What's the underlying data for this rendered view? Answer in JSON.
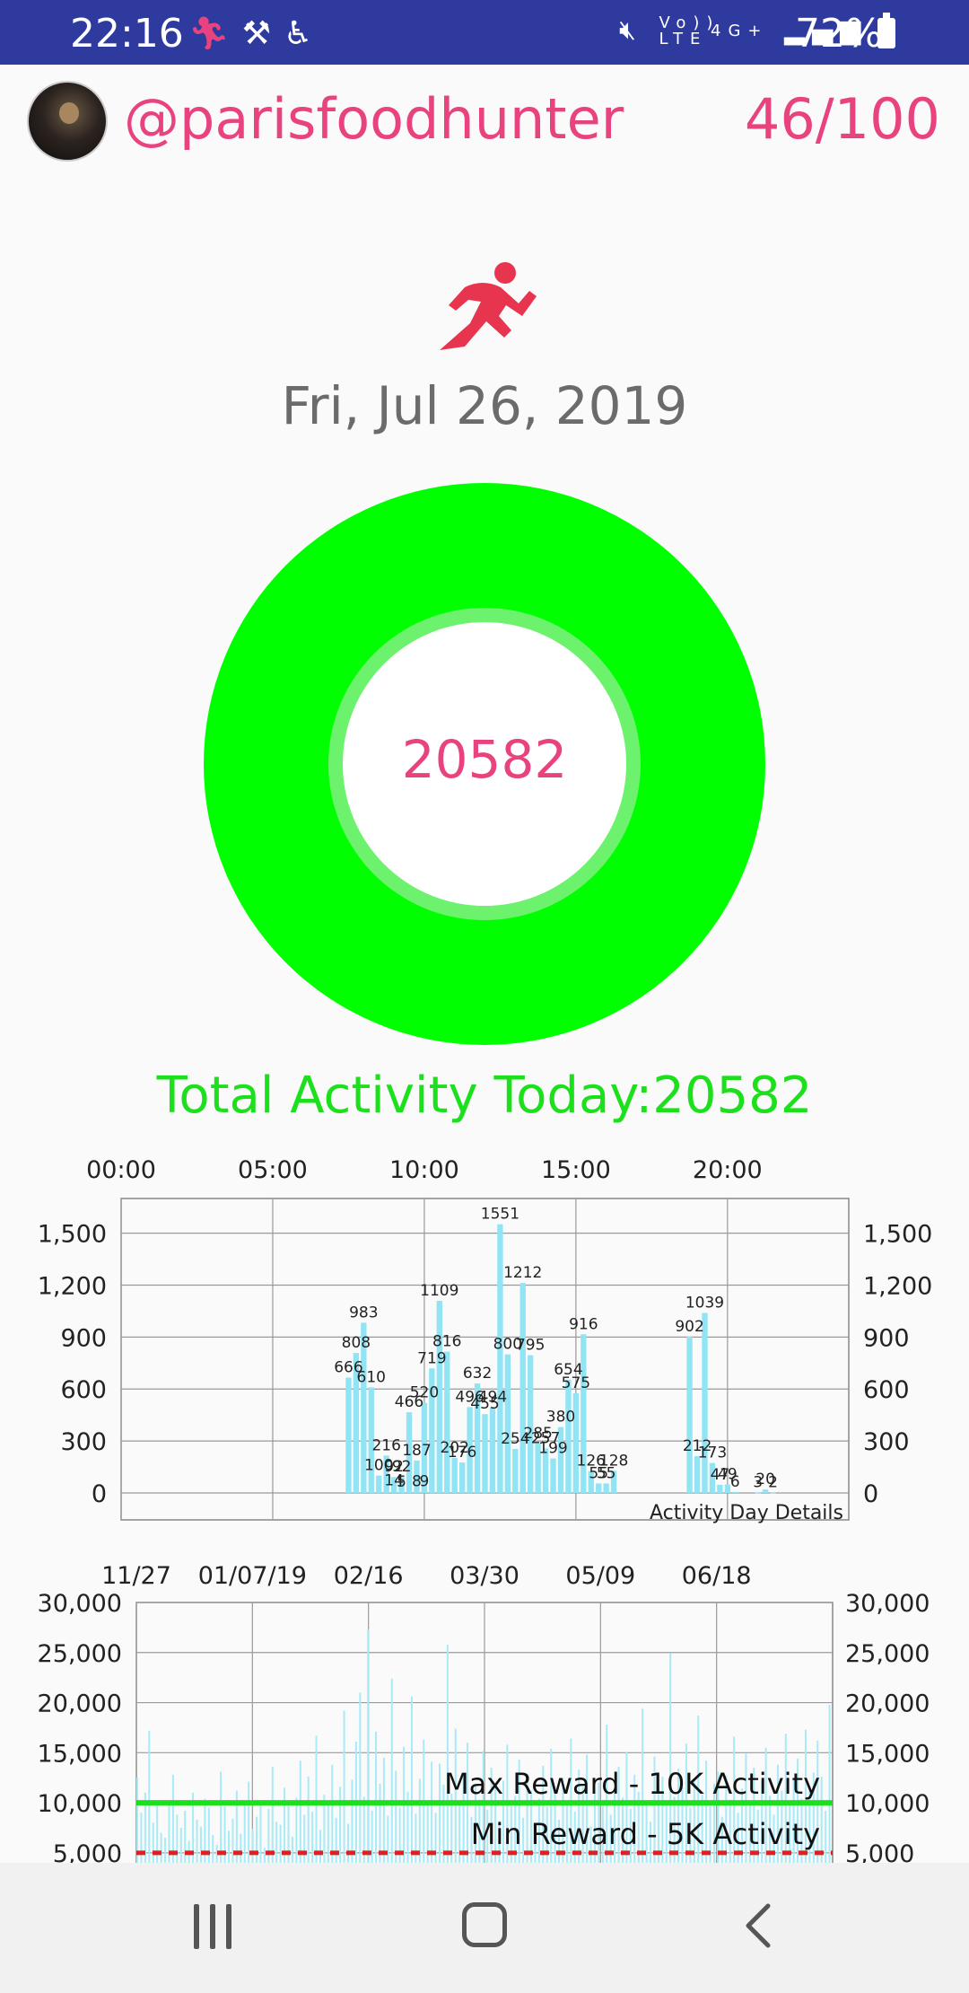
{
  "status_bar": {
    "time": "22:16",
    "left_icons": [
      "running-notification-icon",
      "broom-icon",
      "accessibility-icon"
    ],
    "right_icons": [
      "mute-icon",
      "volte-icon",
      "4g-icon",
      "signal-icon"
    ],
    "network_volte": "Vo)) LTE",
    "network_4g": "4G+",
    "battery_percent": "72%",
    "color": "#2e3a9e"
  },
  "header": {
    "username": "@parisfoodhunter",
    "progress": "46/100",
    "accent_color": "#e8437f"
  },
  "date": "Fri, Jul 26, 2019",
  "ring": {
    "value": "20582",
    "ring_color": "#00ff00",
    "inner_ring_color": "#6cf26c"
  },
  "total_activity": "Total Activity Today:20582",
  "daily_chart": {
    "x_ticks": [
      "00:00",
      "05:00",
      "10:00",
      "15:00",
      "20:00"
    ],
    "y_ticks": [
      "0",
      "300",
      "600",
      "900",
      "1,200",
      "1,500"
    ],
    "caption": "Activity Day Details"
  },
  "history_chart": {
    "x_ticks": [
      "11/27",
      "01/07/19",
      "02/16",
      "03/30",
      "05/09",
      "06/18"
    ],
    "y_ticks": [
      "5,000",
      "10,000",
      "15,000",
      "20,000",
      "25,000",
      "30,000"
    ],
    "max_line_label": "Max Reward - 10K Activity",
    "min_line_label": "Min Reward - 5K Activity"
  },
  "chart_data": [
    {
      "type": "bar",
      "title": "",
      "caption": "Activity Day Details",
      "x_unit": "hour of day",
      "xlim": [
        0,
        24
      ],
      "ylim": [
        0,
        1700
      ],
      "y_ticks": [
        0,
        300,
        600,
        900,
        1200,
        1500
      ],
      "bar_color": "#90e4f4",
      "points": [
        {
          "x": 9.0,
          "y": 14,
          "label": "14"
        },
        {
          "x": 9.25,
          "y": 5,
          "label": "5"
        },
        {
          "x": 9.75,
          "y": 8,
          "label": "8"
        },
        {
          "x": 10.0,
          "y": 9,
          "label": "9"
        },
        {
          "x": 7.5,
          "y": 666,
          "label": "666"
        },
        {
          "x": 7.75,
          "y": 808,
          "label": "808"
        },
        {
          "x": 8.0,
          "y": 983,
          "label": "983"
        },
        {
          "x": 8.25,
          "y": 610,
          "label": "610"
        },
        {
          "x": 8.5,
          "y": 100,
          "label": "100"
        },
        {
          "x": 8.75,
          "y": 216,
          "label": "216"
        },
        {
          "x": 9.0,
          "y": 92,
          "label": "92"
        },
        {
          "x": 9.25,
          "y": 92,
          "label": "92"
        },
        {
          "x": 9.5,
          "y": 466,
          "label": "466"
        },
        {
          "x": 9.75,
          "y": 187,
          "label": "187"
        },
        {
          "x": 10.0,
          "y": 520,
          "label": "520"
        },
        {
          "x": 10.25,
          "y": 719,
          "label": "719"
        },
        {
          "x": 10.5,
          "y": 1109,
          "label": "1109"
        },
        {
          "x": 10.75,
          "y": 816,
          "label": "816"
        },
        {
          "x": 11.0,
          "y": 202,
          "label": "202"
        },
        {
          "x": 11.25,
          "y": 176,
          "label": "176"
        },
        {
          "x": 11.5,
          "y": 496,
          "label": "496"
        },
        {
          "x": 11.75,
          "y": 632,
          "label": "632"
        },
        {
          "x": 12.0,
          "y": 455,
          "label": "455"
        },
        {
          "x": 12.25,
          "y": 494,
          "label": "494"
        },
        {
          "x": 12.5,
          "y": 1551,
          "label": "1551"
        },
        {
          "x": 12.75,
          "y": 800,
          "label": "800"
        },
        {
          "x": 13.0,
          "y": 254,
          "label": "254"
        },
        {
          "x": 13.25,
          "y": 1212,
          "label": "1212"
        },
        {
          "x": 13.5,
          "y": 795,
          "label": "795"
        },
        {
          "x": 13.75,
          "y": 285,
          "label": "285"
        },
        {
          "x": 14.0,
          "y": 257,
          "label": "257"
        },
        {
          "x": 14.25,
          "y": 199,
          "label": "199"
        },
        {
          "x": 14.5,
          "y": 380,
          "label": "380"
        },
        {
          "x": 14.75,
          "y": 654,
          "label": "654"
        },
        {
          "x": 15.0,
          "y": 575,
          "label": "575"
        },
        {
          "x": 15.25,
          "y": 916,
          "label": "916"
        },
        {
          "x": 15.5,
          "y": 126,
          "label": "126"
        },
        {
          "x": 15.75,
          "y": 55,
          "label": "55"
        },
        {
          "x": 16.0,
          "y": 55,
          "label": "55"
        },
        {
          "x": 16.25,
          "y": 128,
          "label": "128"
        },
        {
          "x": 18.75,
          "y": 902,
          "label": "902"
        },
        {
          "x": 19.0,
          "y": 212,
          "label": "212"
        },
        {
          "x": 19.25,
          "y": 1039,
          "label": "1039"
        },
        {
          "x": 19.5,
          "y": 173,
          "label": "173"
        },
        {
          "x": 19.75,
          "y": 47,
          "label": "47"
        },
        {
          "x": 20.0,
          "y": 49,
          "label": "49"
        },
        {
          "x": 20.25,
          "y": 6,
          "label": "6"
        },
        {
          "x": 21.0,
          "y": 3,
          "label": "3"
        },
        {
          "x": 21.25,
          "y": 20,
          "label": "20"
        },
        {
          "x": 21.5,
          "y": 2,
          "label": "2"
        }
      ]
    },
    {
      "type": "bar",
      "title": "",
      "x_labels": [
        "11/27",
        "01/07/19",
        "02/16",
        "03/30",
        "05/09",
        "06/18"
      ],
      "ylim": [
        4000,
        30000
      ],
      "y_ticks": [
        5000,
        10000,
        15000,
        20000,
        25000,
        30000
      ],
      "bar_color": "#a8eaf6",
      "reference_lines": [
        {
          "label": "Max Reward - 10K Activity",
          "value": 10000,
          "color": "#1de01d",
          "style": "solid"
        },
        {
          "label": "Min Reward - 5K Activity",
          "value": 5000,
          "color": "#e02020",
          "style": "dashed"
        }
      ],
      "values": [
        12500,
        9000,
        11000,
        17200,
        8000,
        9800,
        7000,
        6500,
        10000,
        12800,
        8800,
        7500,
        9200,
        6200,
        11000,
        8300,
        7600,
        10400,
        9500,
        6800,
        5800,
        13100,
        9600,
        7200,
        8400,
        11200,
        6900,
        9800,
        12100,
        7400,
        8600,
        10200,
        5500,
        9400,
        13600,
        8100,
        7800,
        11500,
        9700,
        6600,
        10500,
        14200,
        8800,
        12600,
        9100,
        16700,
        7300,
        10800,
        9900,
        13800,
        8500,
        11600,
        19200,
        7900,
        12300,
        16100,
        21000,
        10600,
        27300,
        9200,
        17100,
        11900,
        14500,
        8700,
        22400,
        13200,
        9500,
        15600,
        11100,
        20600,
        8900,
        12400,
        16300,
        10100,
        14100,
        9000,
        13900,
        11800,
        25800,
        10900,
        17400,
        9800,
        12700,
        16000,
        8600,
        11700,
        10300,
        15200,
        9300,
        13500,
        11400,
        8200,
        12200,
        15800,
        9700,
        10700,
        14300,
        8500,
        12900,
        11200,
        7700,
        10400,
        13700,
        9600,
        15400,
        11000,
        8300,
        12500,
        10000,
        16400,
        9100,
        13300,
        11600,
        14800,
        7600,
        10900,
        12000,
        9900,
        17800,
        8800,
        11300,
        13600,
        10500,
        15100,
        9400,
        12800,
        11100,
        19400,
        10200,
        8100,
        14600,
        11800,
        12600,
        9800,
        24900,
        10600,
        13400,
        11500,
        15900,
        9500,
        12300,
        18700,
        10800,
        14200,
        9700,
        11900,
        13100,
        8600,
        12700,
        10300,
        16600,
        9000,
        11400,
        14900,
        10100,
        13500,
        9300,
        12100,
        15500,
        10700,
        8800,
        13800,
        11200,
        16900,
        9900,
        12400,
        14400,
        10400,
        17300,
        11700,
        13000,
        16200,
        12600,
        9200,
        19800
      ]
    }
  ]
}
